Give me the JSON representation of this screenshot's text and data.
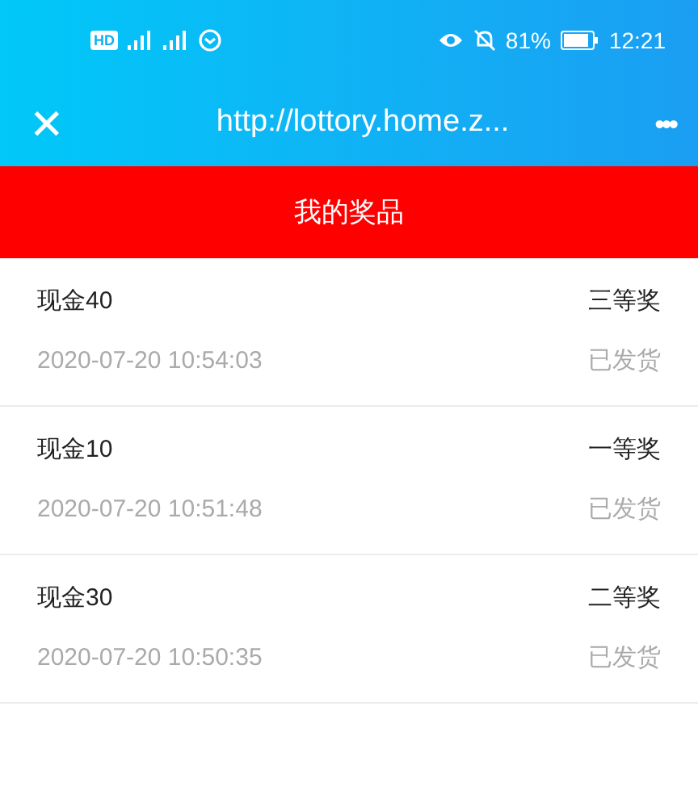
{
  "status_bar": {
    "hd_badge": "HD",
    "battery": "81%",
    "time": "12:21"
  },
  "nav": {
    "close": "✕",
    "url": "http://lottory.home.z...",
    "more": "•••"
  },
  "header": {
    "title": "我的奖品"
  },
  "prizes": [
    {
      "name": "现金40",
      "level": "三等奖",
      "time": "2020-07-20 10:54:03",
      "status": "已发货"
    },
    {
      "name": "现金10",
      "level": "一等奖",
      "time": "2020-07-20 10:51:48",
      "status": "已发货"
    },
    {
      "name": "现金30",
      "level": "二等奖",
      "time": "2020-07-20 10:50:35",
      "status": "已发货"
    }
  ]
}
